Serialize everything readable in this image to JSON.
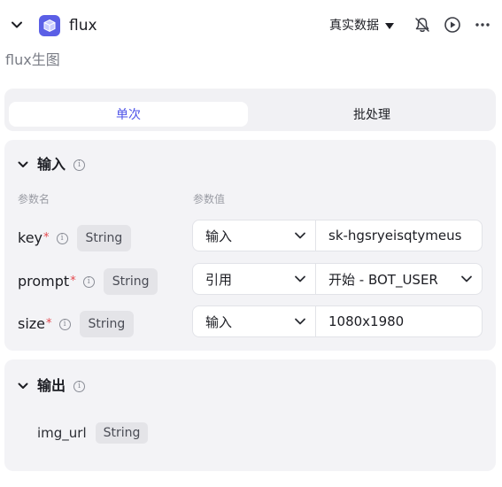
{
  "header": {
    "title": "flux",
    "subtitle": "flux生图",
    "data_mode": "真实数据",
    "icons": [
      "chevron-down-icon",
      "cube-app-icon",
      "bell-off-icon",
      "play-circle-icon",
      "more-icon"
    ]
  },
  "tabs": [
    {
      "label": "单次",
      "active": true
    },
    {
      "label": "批处理",
      "active": false
    }
  ],
  "input_section": {
    "title": "输入",
    "col_name": "参数名",
    "col_value": "参数值",
    "params": [
      {
        "name": "key",
        "required": "*",
        "type": "String",
        "mode": "输入",
        "value": "sk-hgsryeisqtymeus"
      },
      {
        "name": "prompt",
        "required": "*",
        "type": "String",
        "mode": "引用",
        "value": "开始 - BOT_USER"
      },
      {
        "name": "size",
        "required": "*",
        "type": "String",
        "mode": "输入",
        "value": "1080x1980"
      }
    ]
  },
  "output_section": {
    "title": "输出",
    "fields": [
      {
        "name": "img_url",
        "type": "String"
      }
    ]
  },
  "colors": {
    "accent": "#4e53e8",
    "app_icon_bg": "#5b5fe6",
    "required_star": "#e5484d"
  }
}
